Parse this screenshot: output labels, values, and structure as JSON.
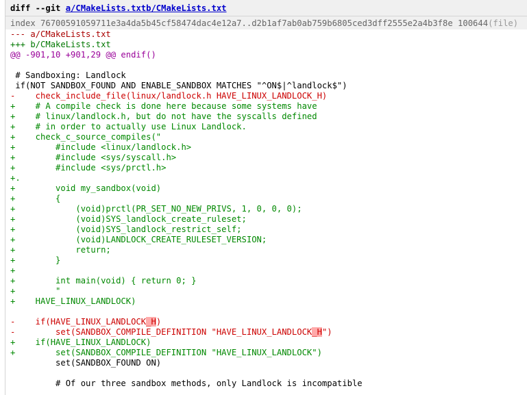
{
  "diff_header": {
    "prefix": "diff --git ",
    "file_a": "a/CMakeLists.txt",
    "file_b": "b/CMakeLists.txt"
  },
  "index_line": {
    "text": "index 76700591059711e3a4da5b45cf58474dac4e12a7..d2b1af7ab0ab759b6805ced3dff2555e2a4b3f8e 100644",
    "mode": "(file)"
  },
  "from_file": "--- a/CMakeLists.txt",
  "to_file": "+++ b/CMakeLists.txt",
  "chunk_header": "@@ -901,10 +901,29 @@ endif()",
  "lines": [
    {
      "type": "ctx",
      "text": ""
    },
    {
      "type": "ctx",
      "text": " # Sandboxing: Landlock"
    },
    {
      "type": "ctx",
      "text": " if(NOT SANDBOX_FOUND AND ENABLE_SANDBOX MATCHES \"^ON$|^landlock$\")"
    },
    {
      "type": "del",
      "text": "-    check_include_file(linux/landlock.h HAVE_LINUX_LANDLOCK_H)"
    },
    {
      "type": "add",
      "text": "+    # A compile check is done here because some systems have"
    },
    {
      "type": "add",
      "text": "+    # linux/landlock.h, but do not have the syscalls defined"
    },
    {
      "type": "add",
      "text": "+    # in order to actually use Linux Landlock."
    },
    {
      "type": "add",
      "text": "+    check_c_source_compiles(\""
    },
    {
      "type": "add",
      "text": "+        #include <linux/landlock.h>"
    },
    {
      "type": "add",
      "text": "+        #include <sys/syscall.h>"
    },
    {
      "type": "add",
      "text": "+        #include <sys/prctl.h>"
    },
    {
      "type": "add",
      "text": "+."
    },
    {
      "type": "add",
      "text": "+        void my_sandbox(void)"
    },
    {
      "type": "add",
      "text": "+        {"
    },
    {
      "type": "add",
      "text": "+            (void)prctl(PR_SET_NO_NEW_PRIVS, 1, 0, 0, 0);"
    },
    {
      "type": "add",
      "text": "+            (void)SYS_landlock_create_ruleset;"
    },
    {
      "type": "add",
      "text": "+            (void)SYS_landlock_restrict_self;"
    },
    {
      "type": "add",
      "text": "+            (void)LANDLOCK_CREATE_RULESET_VERSION;"
    },
    {
      "type": "add",
      "text": "+            return;"
    },
    {
      "type": "add",
      "text": "+        }"
    },
    {
      "type": "add",
      "text": "+"
    },
    {
      "type": "add",
      "text": "+        int main(void) { return 0; }"
    },
    {
      "type": "add",
      "text": "+        \""
    },
    {
      "type": "add",
      "text": "+    HAVE_LINUX_LANDLOCK)"
    },
    {
      "type": "ctx",
      "text": ""
    },
    {
      "type": "del",
      "pre": "-    if(HAVE_LINUX_LANDLOCK",
      "hl": "_H",
      "post": ")"
    },
    {
      "type": "del",
      "pre": "-        set(SANDBOX_COMPILE_DEFINITION \"HAVE_LINUX_LANDLOCK",
      "hl": "_H",
      "post": "\")"
    },
    {
      "type": "add",
      "text": "+    if(HAVE_LINUX_LANDLOCK)"
    },
    {
      "type": "add",
      "text": "+        set(SANDBOX_COMPILE_DEFINITION \"HAVE_LINUX_LANDLOCK\")"
    },
    {
      "type": "ctx",
      "text": "         set(SANDBOX_FOUND ON)"
    },
    {
      "type": "ctx",
      "text": ""
    },
    {
      "type": "ctx",
      "text": "         # Of our three sandbox methods, only Landlock is incompatible"
    }
  ]
}
